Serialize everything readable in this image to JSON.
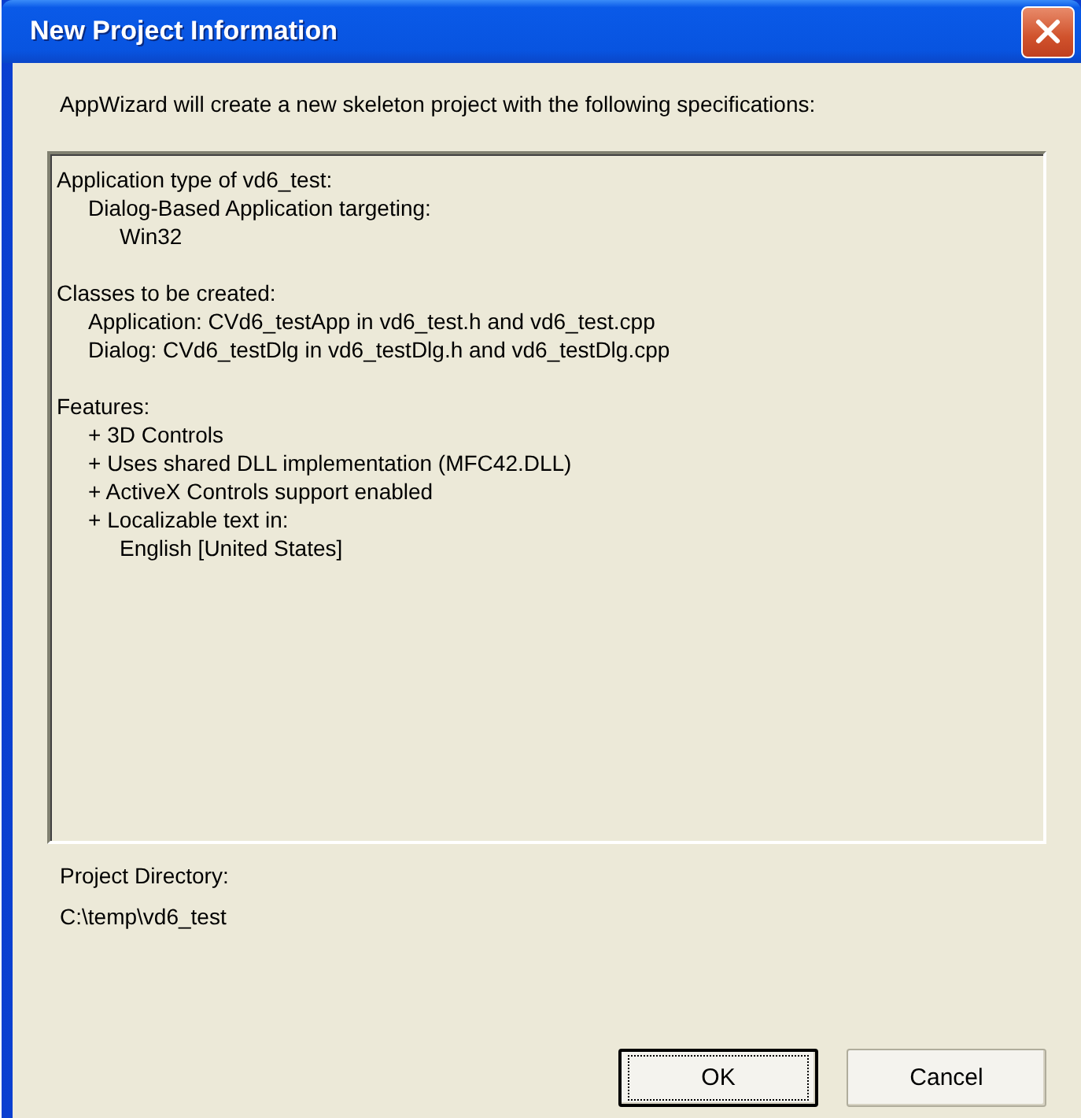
{
  "window": {
    "title": "New Project Information"
  },
  "intro": "AppWizard will create a new skeleton project with the following specifications:",
  "specification": [
    {
      "text": "Application type of vd6_test:",
      "children": [
        {
          "text": "Dialog-Based Application targeting:",
          "children": [
            {
              "text": "Win32"
            }
          ]
        }
      ]
    },
    {
      "text": "Classes to be created:",
      "children": [
        {
          "text": "Application: CVd6_testApp in vd6_test.h and vd6_test.cpp"
        },
        {
          "text": "Dialog: CVd6_testDlg in vd6_testDlg.h and vd6_testDlg.cpp"
        }
      ]
    },
    {
      "text": "Features:",
      "children": [
        {
          "text": "+ 3D Controls"
        },
        {
          "text": "+ Uses shared DLL implementation (MFC42.DLL)"
        },
        {
          "text": "+ ActiveX Controls support enabled"
        },
        {
          "text": "+ Localizable text in:",
          "children": [
            {
              "text": "English [United States]"
            }
          ]
        }
      ]
    }
  ],
  "project_directory": {
    "label": "Project Directory:",
    "value": "C:\\temp\\vd6_test"
  },
  "buttons": [
    {
      "label": "OK",
      "default": true
    },
    {
      "label": "Cancel",
      "default": false
    }
  ]
}
